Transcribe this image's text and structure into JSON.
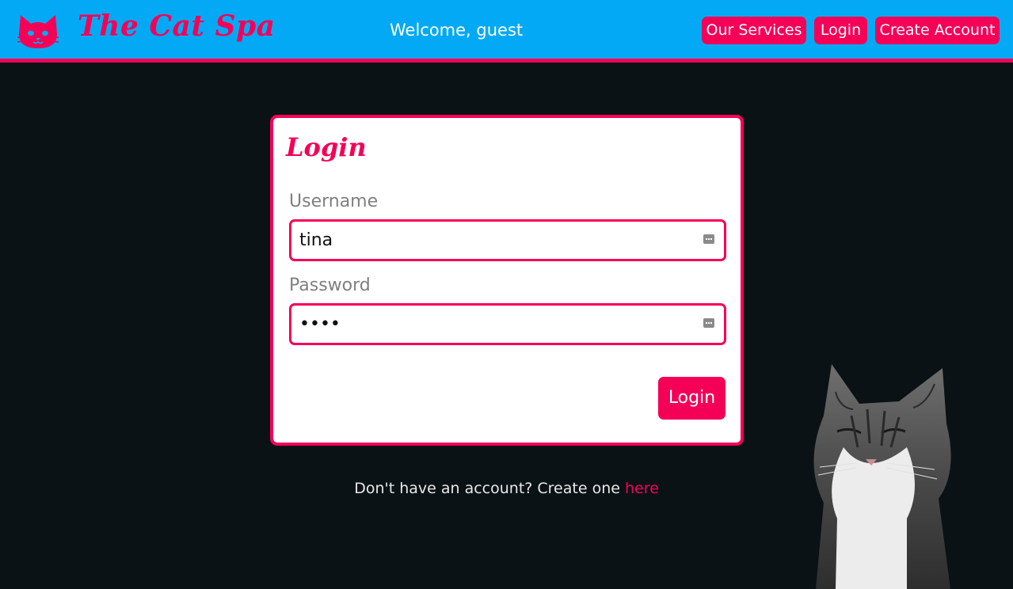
{
  "nav": {
    "brand_icon": "cat-face-icon",
    "brand_name": "The Cat Spa",
    "welcome": "Welcome, guest",
    "buttons": {
      "services": "Our Services",
      "login": "Login",
      "create_account": "Create Account"
    }
  },
  "login_card": {
    "title": "Login",
    "username": {
      "label": "Username",
      "value": "tina"
    },
    "password": {
      "label": "Password",
      "value": "••••"
    },
    "submit": "Login"
  },
  "signup": {
    "text": "Don't have an account? Create one ",
    "link": "here"
  },
  "colors": {
    "navbar": "#03a9f4",
    "accent": "#f50057",
    "background": "#0b1216"
  }
}
